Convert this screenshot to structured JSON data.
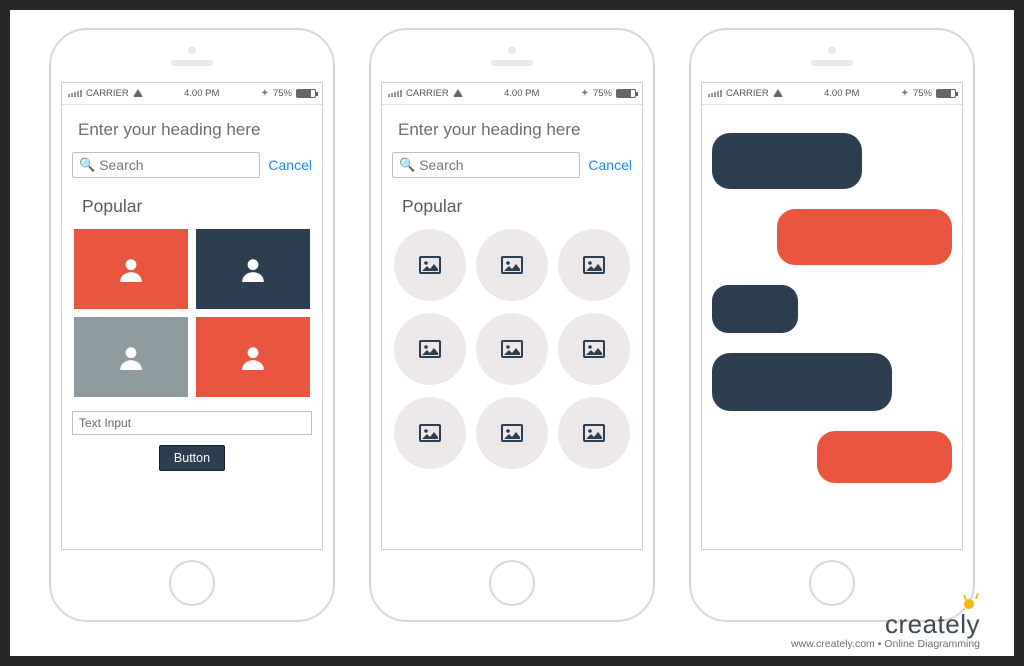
{
  "colors": {
    "navy": "#2c3e50",
    "orange": "#e8563f",
    "grey": "#8d9a9e",
    "light": "#ece8ea"
  },
  "status": {
    "carrier": "CARRIER",
    "time": "4.00 PM",
    "battery": "75%"
  },
  "phone1": {
    "heading": "Enter your heading here",
    "search_placeholder": "Search",
    "cancel": "Cancel",
    "section": "Popular",
    "tiles": [
      {
        "color": "orange",
        "icon": "user-icon"
      },
      {
        "color": "navy",
        "icon": "user-icon"
      },
      {
        "color": "grey",
        "icon": "user-icon"
      },
      {
        "color": "orange",
        "icon": "user-icon"
      }
    ],
    "text_input": "Text Input",
    "button": "Button"
  },
  "phone2": {
    "heading": "Enter your heading here",
    "search_placeholder": "Search",
    "cancel": "Cancel",
    "section": "Popular",
    "items": [
      {
        "icon": "image-icon"
      },
      {
        "icon": "image-icon"
      },
      {
        "icon": "image-icon"
      },
      {
        "icon": "image-icon"
      },
      {
        "icon": "image-icon"
      },
      {
        "icon": "image-icon"
      },
      {
        "icon": "image-icon"
      },
      {
        "icon": "image-icon"
      },
      {
        "icon": "image-icon"
      }
    ]
  },
  "phone3": {
    "bubbles": [
      {
        "side": "left",
        "color": "navy",
        "size": "lg"
      },
      {
        "side": "right",
        "color": "orange",
        "size": "lg"
      },
      {
        "side": "left",
        "color": "navy",
        "size": "sm"
      },
      {
        "side": "left",
        "color": "navy",
        "size": "lg"
      },
      {
        "side": "right",
        "color": "orange",
        "size": "md"
      }
    ]
  },
  "footer": {
    "brand": "creately",
    "tagline": "www.creately.com • Online Diagramming"
  }
}
